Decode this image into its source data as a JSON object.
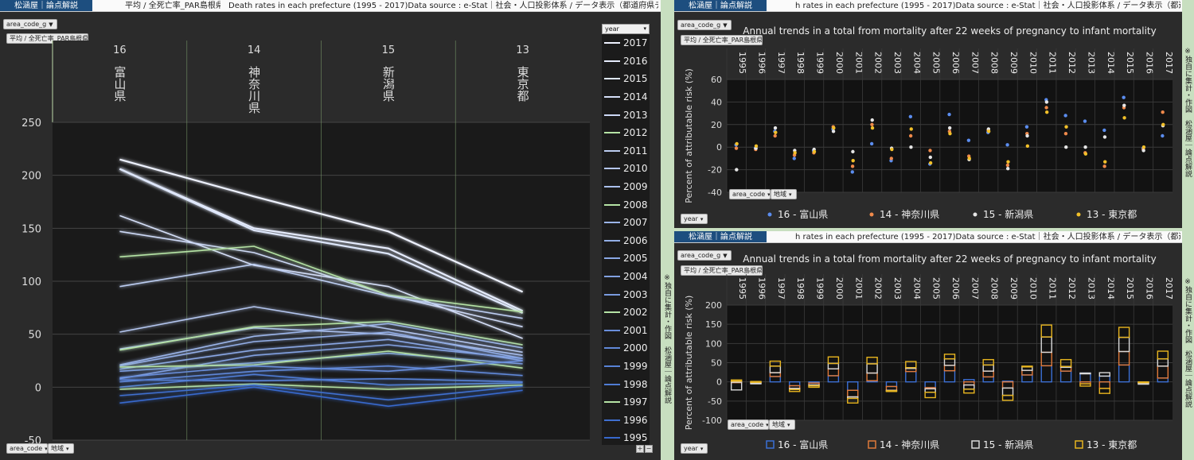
{
  "left": {
    "brand": "松涵屋｜論点解説",
    "crumb1": "平均 / 全死亡率_PAR島根県",
    "crumb2": "Death rates in each prefecture (1995 - 2017)Data source : e-Stat｜社会・人口投影体系 / データ表示（都道府県データ)",
    "filter_label": "area_code_g",
    "measure_label": "平均 / 全死亡率_PAR島根県",
    "year_label": "year",
    "area_code_label": "area_code",
    "region_label": "地域",
    "side_note": "※独自に集計・作図　松涵屋｜論点解説"
  },
  "right_top": {
    "brand": "松涵屋｜論点解説",
    "crumb": "h rates in each prefecture (1995 - 2017)Data source : e-Stat｜社会・人口投影体系 / データ表示（都道府県データ)",
    "filter_label": "area_code_g",
    "measure_label": "平均 / 全死亡率_PAR島根県",
    "area_code_label": "area_code",
    "region_label": "地域",
    "year_label": "year",
    "side_note": "※独自に集計・作図　松涵屋｜論点解説"
  },
  "right_bottom": {
    "brand": "松涵屋｜論点解説",
    "crumb": "h rates in each prefecture (1995 - 2017)Data source : e-Stat｜社会・人口投影体系 / データ表示（都道府県データ)",
    "filter_label": "area_code_g",
    "measure_label": "平均 / 全死亡率_PAR島根県",
    "area_code_label": "area_code",
    "region_label": "地域",
    "year_label": "year",
    "side_note": "※独自に集計・作図　松涵屋｜論点解説"
  },
  "chart_data": [
    {
      "type": "line",
      "title": "",
      "categories_code": [
        "16",
        "14",
        "15",
        "13"
      ],
      "categories": [
        "富山県",
        "神奈川県",
        "新潟県",
        "東京都"
      ],
      "ylim": [
        -50,
        250
      ],
      "yticks": [
        -50,
        0,
        50,
        100,
        150,
        200,
        250
      ],
      "legend_title": "year",
      "series": [
        {
          "name": "2017",
          "values": [
            215,
            180,
            147,
            90
          ]
        },
        {
          "name": "2016",
          "values": [
            206,
            150,
            131,
            72
          ]
        },
        {
          "name": "2015",
          "values": [
            206,
            148,
            126,
            70
          ]
        },
        {
          "name": "2014",
          "values": [
            162,
            115,
            95,
            46
          ]
        },
        {
          "name": "2013",
          "values": [
            147,
            127,
            87,
            57
          ]
        },
        {
          "name": "2012",
          "values": [
            123,
            133,
            87,
            71
          ]
        },
        {
          "name": "2011",
          "values": [
            95,
            116,
            86,
            65
          ]
        },
        {
          "name": "2010",
          "values": [
            52,
            76,
            55,
            33
          ]
        },
        {
          "name": "2009",
          "values": [
            36,
            56,
            50,
            30
          ]
        },
        {
          "name": "2008",
          "values": [
            35,
            57,
            62,
            40
          ]
        },
        {
          "name": "2007",
          "values": [
            21,
            48,
            60,
            37
          ]
        },
        {
          "name": "2006",
          "values": [
            20,
            43,
            52,
            27
          ]
        },
        {
          "name": "2005",
          "values": [
            17,
            35,
            45,
            25
          ]
        },
        {
          "name": "2004",
          "values": [
            8,
            30,
            40,
            27
          ]
        },
        {
          "name": "2003",
          "values": [
            15,
            23,
            32,
            22
          ]
        },
        {
          "name": "2002",
          "values": [
            19,
            21,
            34,
            18
          ]
        },
        {
          "name": "2001",
          "values": [
            9,
            20,
            15,
            25
          ]
        },
        {
          "name": "2000",
          "values": [
            5,
            15,
            20,
            11
          ]
        },
        {
          "name": "1999",
          "values": [
            7,
            6,
            8,
            5
          ]
        },
        {
          "name": "1998",
          "values": [
            0,
            12,
            2,
            4
          ]
        },
        {
          "name": "1997",
          "values": [
            -2,
            3,
            -2,
            2
          ]
        },
        {
          "name": "1996",
          "values": [
            -8,
            2,
            -12,
            1
          ]
        },
        {
          "name": "1995",
          "values": [
            -15,
            0,
            -18,
            -3
          ]
        }
      ]
    },
    {
      "type": "scatter",
      "title": "Annual trends in a total from mortality after 22 weeks of pregnancy to infant mortality",
      "ylabel": "Percent of attributable risk (%)",
      "ylim": [
        -40,
        60
      ],
      "yticks": [
        -40,
        -20,
        0,
        20,
        40,
        60
      ],
      "x": [
        "1995",
        "1996",
        "1997",
        "1998",
        "1999",
        "2000",
        "2001",
        "2002",
        "2003",
        "2004",
        "2005",
        "2006",
        "2007",
        "2008",
        "2009",
        "2010",
        "2011",
        "2012",
        "2013",
        "2014",
        "2015",
        "2016",
        "2017"
      ],
      "series": [
        {
          "name": "16 - 富山県",
          "color": "#5b8def",
          "values": [
            2,
            -1,
            14,
            -10,
            -3,
            16,
            -22,
            3,
            -12,
            27,
            -15,
            29,
            6,
            13,
            2,
            18,
            42,
            28,
            23,
            15,
            44,
            -1,
            10
          ]
        },
        {
          "name": "14 - 神奈川県",
          "color": "#f08a4b",
          "values": [
            -1,
            -2,
            10,
            -7,
            -5,
            18,
            -17,
            20,
            -10,
            10,
            -3,
            14,
            -8,
            15,
            -16,
            12,
            35,
            12,
            -5,
            -17,
            35,
            -2,
            31
          ]
        },
        {
          "name": "15 - 新潟県",
          "color": "#e6e6e6",
          "values": [
            -20,
            -1,
            17,
            -3,
            -2,
            14,
            -4,
            24,
            -1,
            0,
            -9,
            17,
            -11,
            16,
            -19,
            10,
            40,
            0,
            0,
            9,
            37,
            -3,
            19
          ]
        },
        {
          "name": "13 - 東京都",
          "color": "#f2c029",
          "values": [
            3,
            1,
            13,
            -5,
            -4,
            17,
            -12,
            17,
            -2,
            16,
            -14,
            12,
            -10,
            14,
            -13,
            1,
            31,
            18,
            -6,
            -13,
            26,
            0,
            20
          ]
        }
      ]
    },
    {
      "type": "bar",
      "title": "Annual trends in a total from mortality after 22 weeks of pregnancy to infant mortality",
      "ylabel": "Percent of attributable risk (%)",
      "ylim": [
        -100,
        200
      ],
      "yticks": [
        -100,
        -50,
        0,
        50,
        100,
        150,
        200
      ],
      "x": [
        "1995",
        "1996",
        "1997",
        "1998",
        "1999",
        "2000",
        "2001",
        "2002",
        "2003",
        "2004",
        "2005",
        "2006",
        "2007",
        "2008",
        "2009",
        "2010",
        "2011",
        "2012",
        "2013",
        "2014",
        "2015",
        "2016",
        "2017"
      ],
      "series": [
        {
          "name": "16 - 富山県",
          "color": "#3b6fd4",
          "values": [
            2,
            -1,
            14,
            -10,
            -3,
            16,
            -22,
            3,
            -12,
            27,
            -15,
            29,
            6,
            13,
            2,
            18,
            42,
            28,
            23,
            15,
            44,
            -1,
            10
          ]
        },
        {
          "name": "14 - 神奈川県",
          "color": "#e07a3a",
          "values": [
            -1,
            -2,
            10,
            -7,
            -5,
            18,
            -17,
            20,
            -10,
            10,
            -3,
            14,
            -8,
            15,
            -16,
            12,
            35,
            12,
            -5,
            -17,
            35,
            -2,
            31
          ]
        },
        {
          "name": "15 - 新潟県",
          "color": "#d9d9d9",
          "values": [
            -20,
            -1,
            17,
            -3,
            -2,
            14,
            -4,
            24,
            -1,
            0,
            -9,
            17,
            -11,
            16,
            -19,
            10,
            40,
            0,
            0,
            9,
            37,
            -3,
            19
          ]
        },
        {
          "name": "13 - 東京都",
          "color": "#e8b51f",
          "values": [
            3,
            1,
            13,
            -5,
            -4,
            17,
            -12,
            17,
            -2,
            16,
            -14,
            12,
            -10,
            14,
            -13,
            1,
            31,
            18,
            -6,
            -13,
            26,
            0,
            20
          ]
        }
      ]
    }
  ],
  "colors": {
    "panel_bg": "#2b2b2b",
    "plot_bg": "#1a1a1a",
    "frame": "#c8dfc0",
    "brand": "#1d4e7f"
  }
}
